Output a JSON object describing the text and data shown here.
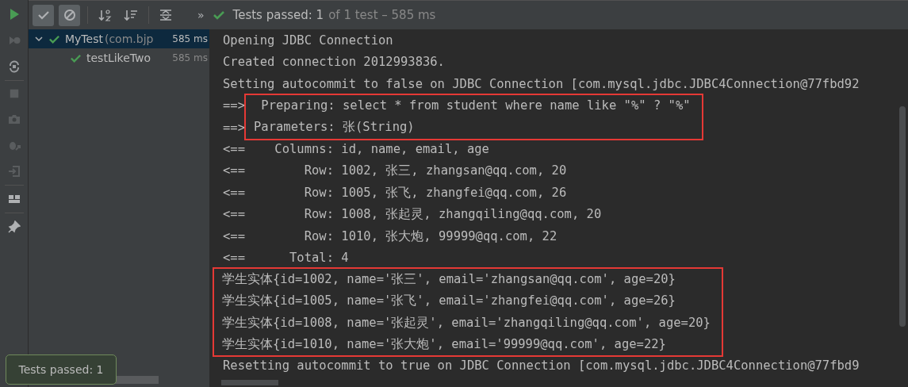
{
  "toolbar": {
    "show_passed": true,
    "show_ignored": true,
    "more": "»"
  },
  "status": {
    "passed": "Tests passed: 1",
    "detail": "of 1 test – 585 ms"
  },
  "tree": [
    {
      "name": "MyTest",
      "detail": "(com.bjp",
      "time": "585 ms",
      "expanded": true,
      "selected": true,
      "passed": true,
      "children": [
        {
          "name": "testLikeTwo",
          "time": "585 ms",
          "selected": false,
          "passed": true
        }
      ]
    }
  ],
  "console": [
    {
      "kind": "plain",
      "lines": [
        {
          "text": "Opening JDBC Connection"
        },
        {
          "text": "Created connection 2012993836."
        },
        {
          "text": "Setting autocommit to false on JDBC Connection [com.mysql.jdbc.JDBC4Connection@77fbd92"
        }
      ]
    },
    {
      "kind": "highlighted",
      "lines": [
        {
          "prefix": "==>",
          "text": " Preparing: select * from student where name like \"%\" ? \"%\""
        },
        {
          "prefix": "==>",
          "text": "Parameters: 张(String)"
        }
      ]
    },
    {
      "kind": "plain",
      "lines": [
        {
          "text": "<==    Columns: id, name, email, age"
        },
        {
          "text": "<==        Row: 1002, 张三, zhangsan@qq.com, 20"
        },
        {
          "text": "<==        Row: 1005, 张飞, zhangfei@qq.com, 26"
        },
        {
          "text": "<==        Row: 1008, 张起灵, zhangqiling@qq.com, 20"
        },
        {
          "text": "<==        Row: 1010, 张大炮, 99999@qq.com, 22"
        },
        {
          "text": "<==      Total: 4"
        }
      ]
    },
    {
      "kind": "highlighted",
      "lines": [
        {
          "text": "学生实体{id=1002, name='张三', email='zhangsan@qq.com', age=20}"
        },
        {
          "text": "学生实体{id=1005, name='张飞', email='zhangfei@qq.com', age=26}"
        },
        {
          "text": "学生实体{id=1008, name='张起灵', email='zhangqiling@qq.com', age=20}"
        },
        {
          "text": "学生实体{id=1010, name='张大炮', email='99999@qq.com', age=22}"
        }
      ]
    },
    {
      "kind": "plain",
      "lines": [
        {
          "text": "Resetting autocommit to true on JDBC Connection [com.mysql.jdbc.JDBC4Connection@77fbd9"
        }
      ]
    }
  ],
  "tooltip": "Tests passed: 1"
}
